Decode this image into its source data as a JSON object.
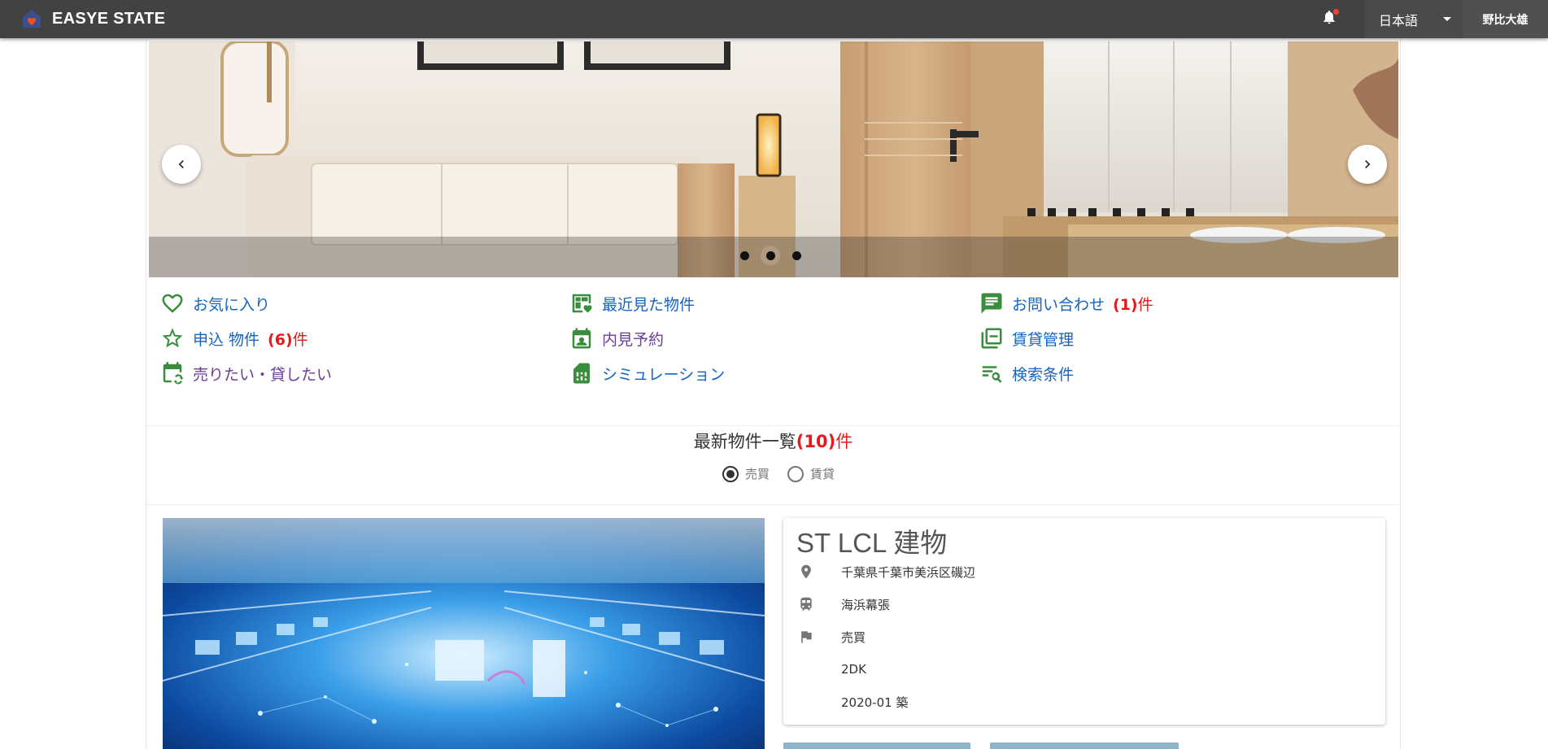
{
  "header": {
    "brand": "EASYE STATE",
    "language": "日本語",
    "user": "野比大雄",
    "bell_icon": "notifications-icon"
  },
  "carousel": {
    "prev_icon": "chevron-left-icon",
    "next_icon": "chevron-right-icon",
    "slide_count": 3,
    "active_slide": 2
  },
  "menu": {
    "favorites": {
      "label": "お気に入り",
      "icon": "heart-outline-icon"
    },
    "recent": {
      "label": "最近見た物件",
      "icon": "recently-viewed-icon"
    },
    "inquiry": {
      "label": "お問い合わせ",
      "count": "(1)",
      "unit": "件",
      "icon": "chat-icon"
    },
    "application": {
      "label": "申込 物件",
      "count": "(6)",
      "unit": "件",
      "icon": "star-outline-icon"
    },
    "viewing": {
      "label": "内見予約",
      "icon": "calendar-contact-icon"
    },
    "rental": {
      "label": "賃貸管理",
      "icon": "library-icon"
    },
    "sell": {
      "label": "売りたい・貸したい",
      "icon": "calendar-sync-icon"
    },
    "simulation": {
      "label": "シミュレーション",
      "icon": "sim-card-icon"
    },
    "search": {
      "label": "検索条件",
      "icon": "search-list-icon"
    }
  },
  "listing": {
    "title": "最新物件一覧",
    "count": "(10)",
    "unit": "件",
    "filters": [
      {
        "label": "売買",
        "selected": true
      },
      {
        "label": "賃貸",
        "selected": false
      }
    ]
  },
  "property": {
    "name": "ST LCL 建物",
    "address": "千葉県千葉市美浜区磯辺",
    "station": "海浜幕張",
    "type": "売買",
    "layout": "2DK",
    "built": "2020-01 築"
  },
  "colors": {
    "topbar": "#424242",
    "link": "#1565c0",
    "count": "#e8181c",
    "icon_green": "#388e3c"
  }
}
